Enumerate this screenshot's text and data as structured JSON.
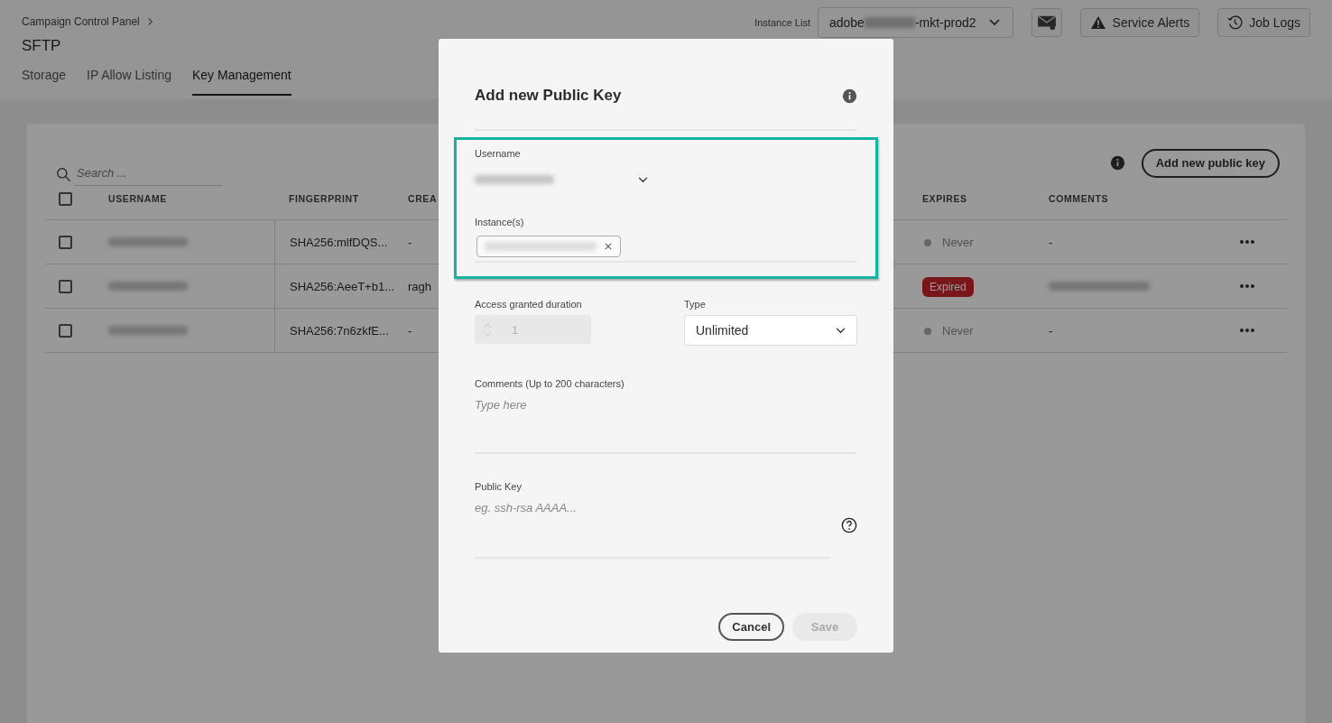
{
  "header": {
    "breadcrumb": "Campaign Control Panel",
    "title": "SFTP",
    "instance_list": {
      "label": "Instance List",
      "value_prefix": "adobe",
      "value_suffix": "-mkt-prod2"
    },
    "buttons": [
      {
        "label": "Service Alerts",
        "kind": "alert"
      },
      {
        "label": "Job Logs",
        "kind": "history"
      }
    ]
  },
  "tabs": [
    {
      "label": "Storage",
      "selected": false
    },
    {
      "label": "IP Allow Listing",
      "selected": false
    },
    {
      "label": "Key Management",
      "selected": true
    }
  ],
  "toolbar": {
    "search_placeholder": "Search ...",
    "add_button": "Add new public key"
  },
  "table": {
    "select_all_checked": false,
    "columns": [
      "USERNAME",
      "FINGERPRINT",
      "CREA",
      "EXPIRES",
      "COMMENTS"
    ],
    "rows": [
      {
        "checked": false,
        "fingerprint": "SHA256:mlfDQS...",
        "column_3": "-",
        "expires": {
          "kind": "status",
          "text": "Never"
        },
        "comment": "-"
      },
      {
        "checked": false,
        "fingerprint": "SHA256:AeeT+b1...",
        "column_3": "ragh",
        "expires": {
          "kind": "badge",
          "text": "Expired"
        },
        "comment_hidden": true
      },
      {
        "checked": false,
        "fingerprint": "SHA256:7n6zkfE...",
        "column_3": "-",
        "expires": {
          "kind": "status",
          "text": "Never"
        },
        "comment": "-"
      }
    ]
  },
  "dialog": {
    "title": "Add new Public Key",
    "username_label": "Username",
    "instances_label": "Instance(s)",
    "duration_label": "Access granted duration",
    "duration_value": "1",
    "duration_disabled": true,
    "type_label": "Type",
    "type_value": "Unlimited",
    "comments_label": "Comments (Up to 200 characters)",
    "comments_placeholder": "Type here",
    "key_label": "Public Key",
    "key_placeholder": "eg. ssh-rsa AAAA...",
    "cancel": "Cancel",
    "save": "Save",
    "save_disabled": true
  }
}
